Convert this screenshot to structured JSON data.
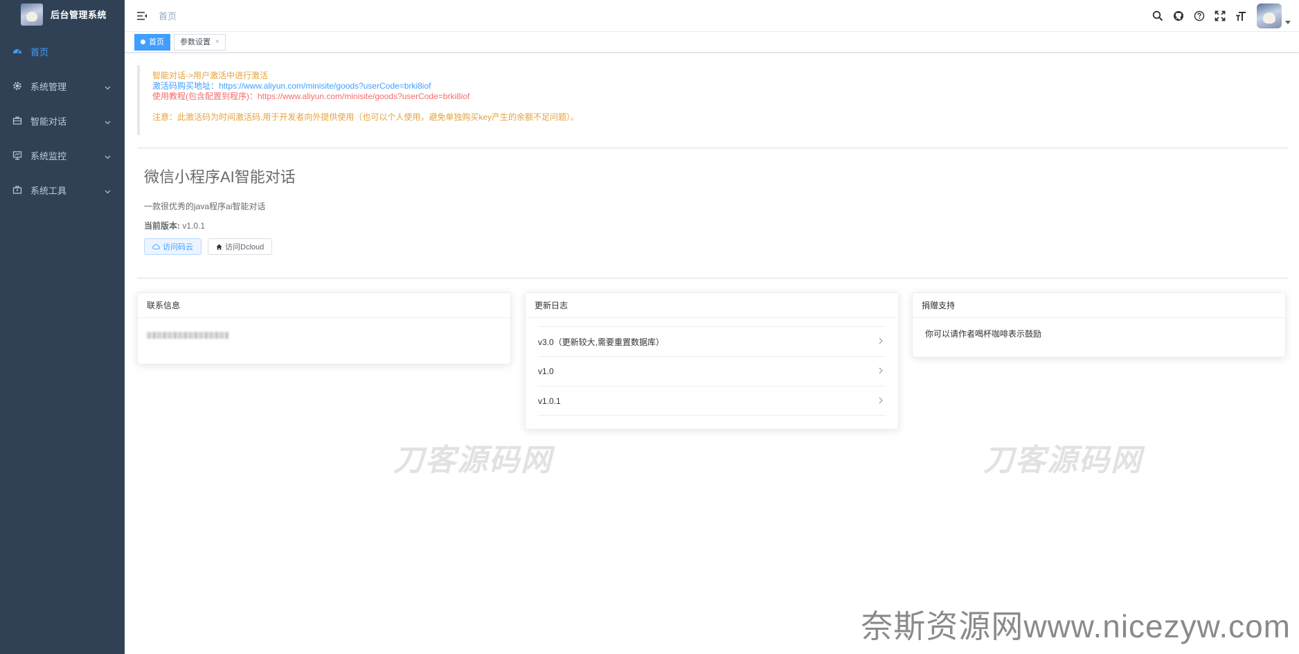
{
  "sidebar": {
    "title": "后台管理系统",
    "items": [
      {
        "label": "首页",
        "icon": "dashboard-icon",
        "active": true
      },
      {
        "label": "系统管理",
        "icon": "gear-icon"
      },
      {
        "label": "智能对话",
        "icon": "briefcase-icon"
      },
      {
        "label": "系统监控",
        "icon": "monitor-icon"
      },
      {
        "label": "系统工具",
        "icon": "toolbox-icon"
      }
    ]
  },
  "navbar": {
    "breadcrumb": "首页",
    "icons": [
      "search-icon",
      "github-icon",
      "help-icon",
      "fullscreen-icon",
      "font-size-icon"
    ]
  },
  "tags": {
    "active": "首页",
    "second": "参数设置",
    "close": "×"
  },
  "notice": {
    "line1": "智能对话->用户激活中进行激活",
    "line2": "激活码购买地址：https://www.aliyun.com/minisite/goods?userCode=brki8iof",
    "line3": "使用教程(包含配置到程序)：https://www.aliyun.com/minisite/goods?userCode=brki8iof",
    "line4": "注意：此激活码为时间激活码,用于开发者向外提供使用（也可以个人使用，避免单独购买key产生的余额不足问题）。",
    "accent_orange": "#e6a23c",
    "accent_blue": "#409eff",
    "accent_red": "#f56c6c"
  },
  "intro": {
    "title": "微信小程序AI智能对话",
    "desc": "一款很优秀的java程序ai智能对话",
    "version_label": "当前版本:",
    "version_value": "v1.0.1",
    "btn_gitee": "访问码云",
    "btn_dcloud": "访问Dcloud"
  },
  "cards": {
    "contact": {
      "title": "联系信息"
    },
    "changelog": {
      "title": "更新日志",
      "items": [
        "v3.0（更新较大,需要重置数据库）",
        "v1.0",
        "v1.0.1"
      ]
    },
    "donate": {
      "title": "捐赠支持",
      "text": "你可以请作者喝杯咖啡表示鼓励"
    }
  },
  "watermarks": {
    "left": "刀客源码网",
    "right": "刀客源码网",
    "site": "奈斯资源网www.nicezyw.com"
  }
}
